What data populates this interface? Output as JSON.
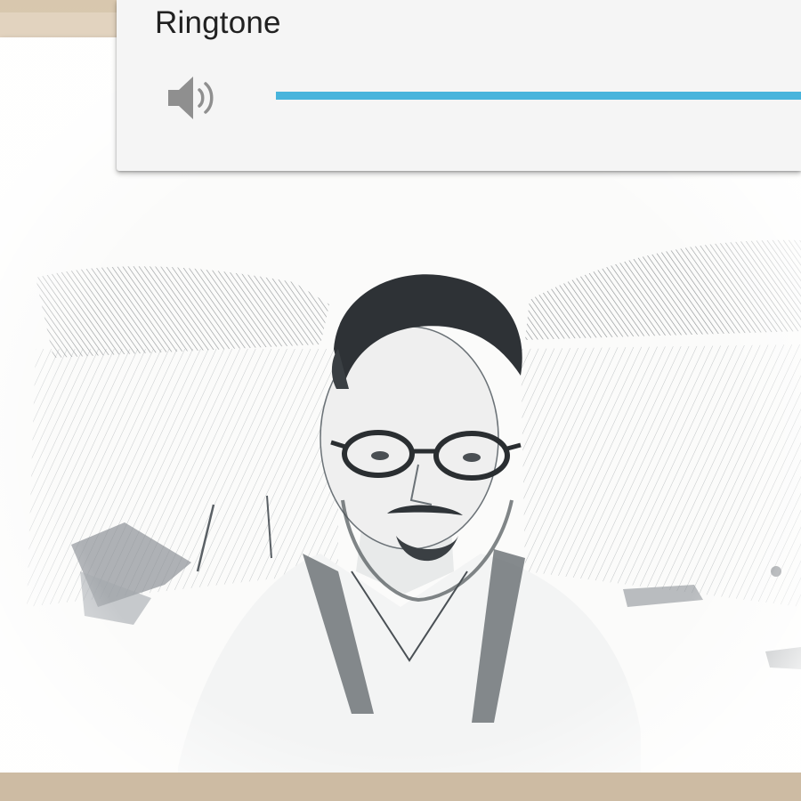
{
  "volume_panel": {
    "title": "Ringtone",
    "icon": "speaker-volume-icon",
    "level_percent": 100,
    "accent_color": "#48b4dc"
  },
  "background": {
    "content": "pencil-sketch-portrait-photo"
  }
}
